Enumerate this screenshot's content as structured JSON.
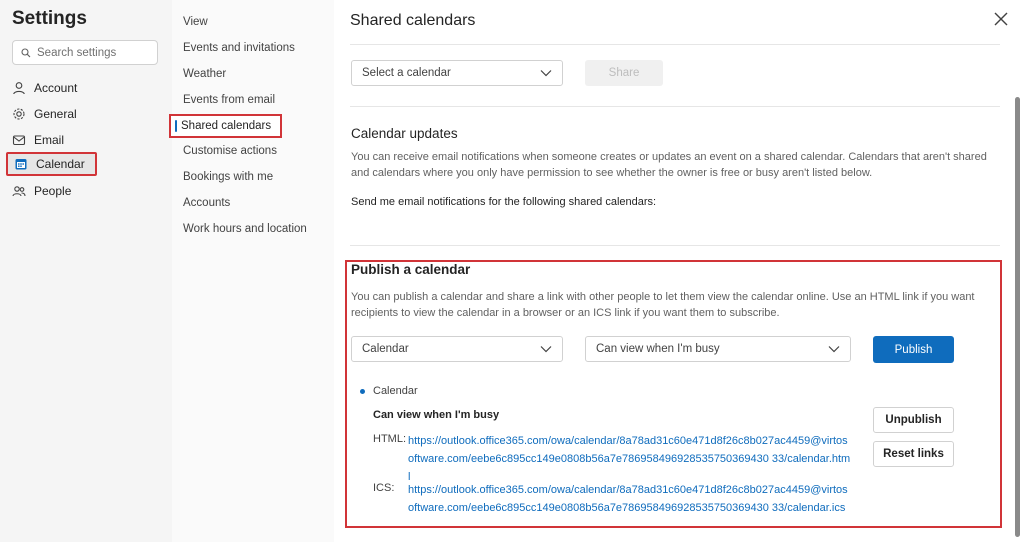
{
  "settings": {
    "title": "Settings",
    "search_placeholder": "Search settings",
    "nav": [
      {
        "label": "Account",
        "icon": "person-icon"
      },
      {
        "label": "General",
        "icon": "gear-icon"
      },
      {
        "label": "Email",
        "icon": "mail-icon"
      },
      {
        "label": "Calendar",
        "icon": "calendar-icon"
      },
      {
        "label": "People",
        "icon": "people-icon"
      }
    ],
    "selected_nav": "Calendar"
  },
  "subnav": {
    "items": [
      "View",
      "Events and invitations",
      "Weather",
      "Events from email",
      "Shared calendars",
      "Customise actions",
      "Bookings with me",
      "Accounts",
      "Work hours and location"
    ],
    "selected": "Shared calendars"
  },
  "panel": {
    "title": "Shared calendars",
    "share": {
      "select_placeholder": "Select a calendar",
      "share_label": "Share"
    },
    "updates": {
      "title": "Calendar updates",
      "description": "You can receive email notifications when someone creates or updates an event on a shared calendar. Calendars that aren't shared and calendars where you only have permission to see whether the owner is free or busy aren't listed below.",
      "send_label": "Send me email notifications for the following shared calendars:"
    },
    "publish": {
      "title": "Publish a calendar",
      "description": "You can publish a calendar and share a link with other people to let them view the calendar online. Use an HTML link if you want recipients to view the calendar in a browser or an ICS link if you want them to subscribe.",
      "calendar_select": "Calendar",
      "permission_select": "Can view when I'm busy",
      "publish_label": "Publish",
      "published": {
        "calendar_name": "Calendar",
        "permission": "Can view when I'm busy",
        "html_label": "HTML:",
        "html_link": "https://outlook.office365.com/owa/calendar/8a78ad31c60e471d8f26c8b027ac4459@virtosoftware.com/eebe6c895cc149e0808b56a7e786958496928535750369430 33/calendar.html",
        "ics_label": "ICS:",
        "ics_link": "https://outlook.office365.com/owa/calendar/8a78ad31c60e471d8f26c8b027ac4459@virtosoftware.com/eebe6c895cc149e0808b56a7e786958496928535750369430 33/calendar.ics",
        "unpublish_label": "Unpublish",
        "reset_label": "Reset links"
      }
    }
  },
  "colors": {
    "accent": "#0f6cbd",
    "highlight": "#d13438"
  }
}
